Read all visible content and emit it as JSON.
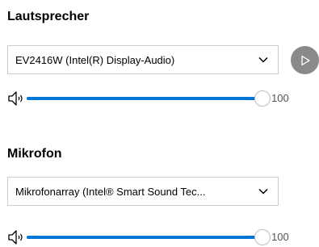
{
  "speaker": {
    "title": "Lautsprecher",
    "device_value": "EV2416W (Intel(R) Display-Audio)",
    "chevron_icon": "chevron-down-icon",
    "play_icon": "play-icon",
    "volume_icon": "speaker-icon",
    "volume_value": "100",
    "volume_level": 1.0
  },
  "microphone": {
    "title": "Mikrofon",
    "device_value": "Mikrofonarray (Intel® Smart Sound Tec...",
    "chevron_icon": "chevron-down-icon",
    "volume_icon": "microphone-level-icon",
    "volume_value": "100",
    "volume_level": 1.0
  },
  "colors": {
    "accent": "#0078d7",
    "play_button": "#8a8a8a"
  }
}
